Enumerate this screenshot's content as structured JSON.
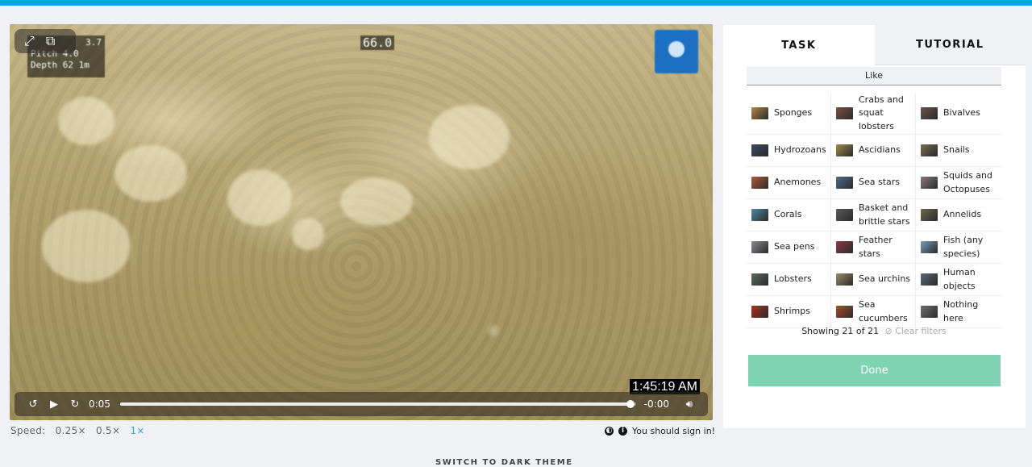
{
  "video": {
    "overlay_depth_lines": [
      "3.7",
      "Pitch 4.0",
      "Depth 62 1m"
    ],
    "overlay_heading": "66.0",
    "timestamp": "1:45:19 AM",
    "controls": {
      "elapsed": "0:05",
      "remaining": "-0:00",
      "progress_fraction": 0.99,
      "rewind_icon": "replay-15-icon",
      "play_icon": "play-icon",
      "forward_icon": "forward-15-icon",
      "volume_icon": "volume-icon"
    },
    "fullscreen_icons": [
      "expand-icon",
      "picture-in-picture-icon"
    ]
  },
  "speed": {
    "label": "Speed:",
    "options": [
      "0.25×",
      "0.5×",
      "1×"
    ],
    "selected": "1×"
  },
  "signin_notice": "You should sign in!",
  "dark_theme_link": "SWITCH TO DARK THEME",
  "panel": {
    "tabs": [
      "TASK",
      "TUTORIAL"
    ],
    "active_tab": "TASK",
    "like_label": "Like",
    "choices": [
      {
        "label": "Sponges",
        "color": "#b3864a"
      },
      {
        "label": "Crabs and squat lobsters",
        "color": "#7a5040"
      },
      {
        "label": "Bivalves",
        "color": "#6a5448"
      },
      {
        "label": "Hydrozoans",
        "color": "#3b4a66"
      },
      {
        "label": "Ascidians",
        "color": "#9e8a48"
      },
      {
        "label": "Snails",
        "color": "#7a6b55"
      },
      {
        "label": "Anemones",
        "color": "#b05a3a"
      },
      {
        "label": "Sea stars",
        "color": "#4d6e8e"
      },
      {
        "label": "Squids and Octopuses",
        "color": "#8a7a78"
      },
      {
        "label": "Corals",
        "color": "#4d8aa0"
      },
      {
        "label": "Basket and brittle stars",
        "color": "#5a5a5a"
      },
      {
        "label": "Annelids",
        "color": "#6d6a4e"
      },
      {
        "label": "Sea pens",
        "color": "#8a8a94"
      },
      {
        "label": "Feather stars",
        "color": "#8c3a4a"
      },
      {
        "label": "Fish (any species)",
        "color": "#7a9ab8"
      },
      {
        "label": "Lobsters",
        "color": "#5e6a62"
      },
      {
        "label": "Sea urchins",
        "color": "#9a8a6a"
      },
      {
        "label": "Human objects",
        "color": "#5a6a7a"
      },
      {
        "label": "Shrimps",
        "color": "#b03020"
      },
      {
        "label": "Sea cucumbers",
        "color": "#b04a2a"
      },
      {
        "label": "Nothing here",
        "color": "#707070"
      }
    ],
    "showing_text": "Showing 21 of 21",
    "clear_filters": "Clear filters",
    "clear_icon": "circle-slash-icon",
    "done_label": "Done"
  }
}
